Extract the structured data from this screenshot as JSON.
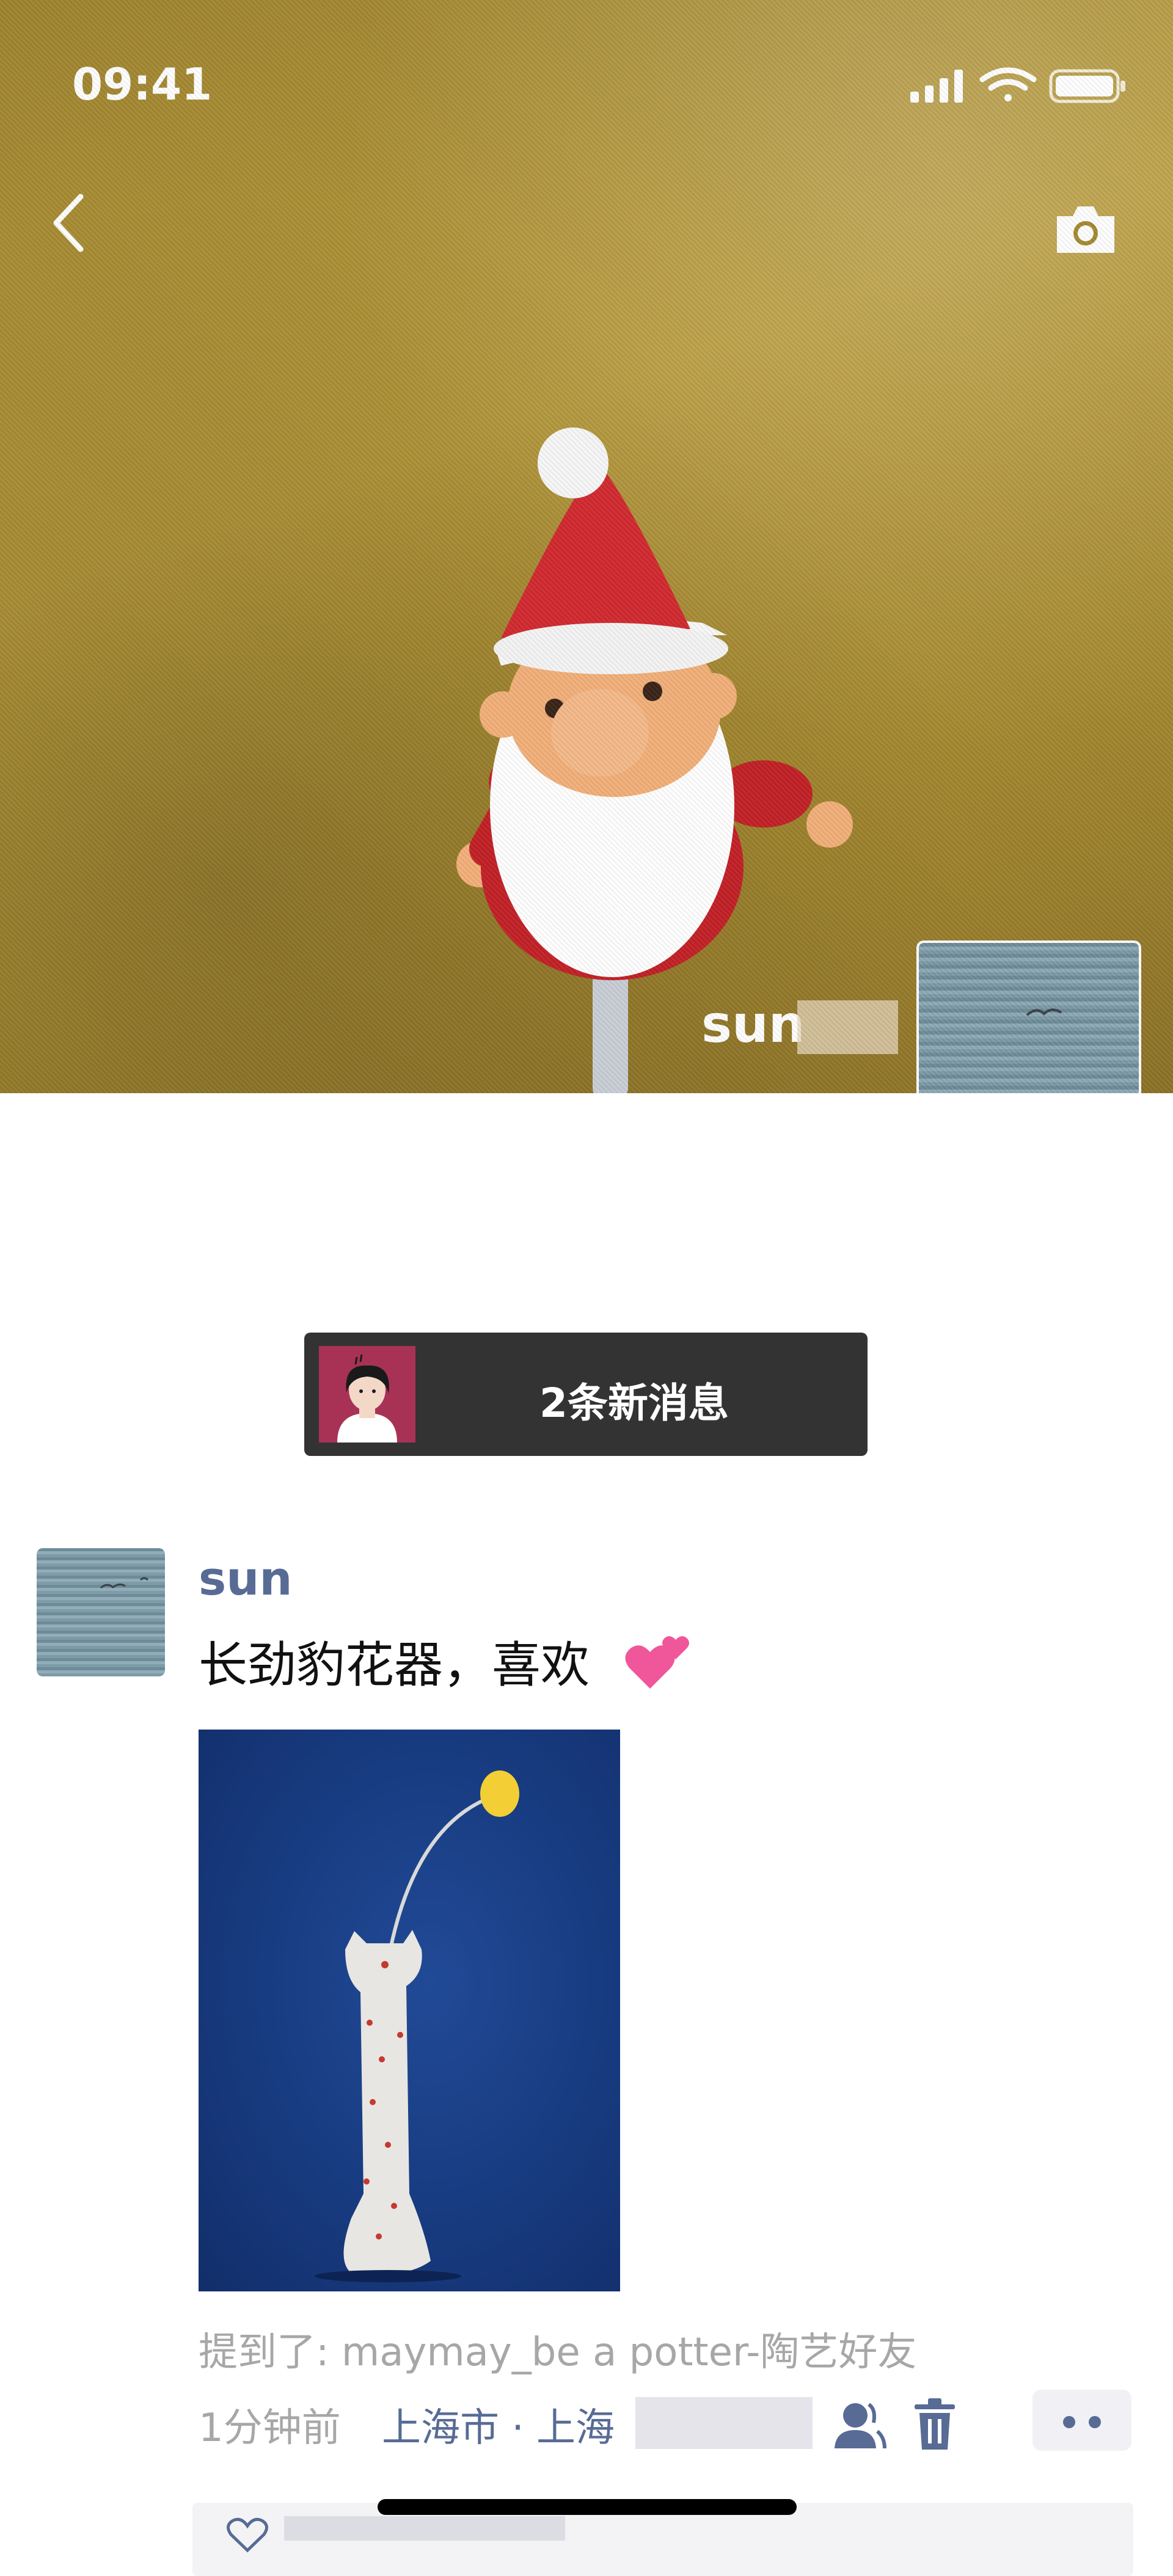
{
  "status_bar": {
    "time": "09:41",
    "icons": [
      "cellular-signal-icon",
      "wifi-icon",
      "battery-icon"
    ]
  },
  "nav": {
    "back_icon": "chevron-left-icon",
    "camera_icon": "camera-icon"
  },
  "cover": {
    "user_name": "sun"
  },
  "notice": {
    "text": "2条新消息"
  },
  "post": {
    "author": "sun",
    "text": "长劲豹花器，喜欢",
    "mention": "提到了: maymay_be a potter-陶艺好友",
    "time": "1分钟前",
    "location": "上海市 · 上海"
  },
  "colors": {
    "link_blue": "#576b95",
    "meta_gray": "#a7a7a7",
    "notice_bg": "#333333"
  }
}
